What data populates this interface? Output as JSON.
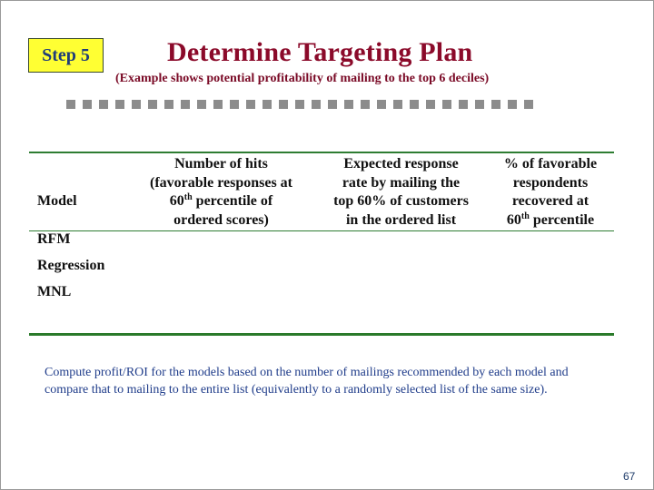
{
  "step_badge": "Step 5",
  "title": "Determine Targeting Plan",
  "subtitle": "(Example shows potential profitability of mailing to the top 6 deciles)",
  "decorative_dot_count": 29,
  "table": {
    "headers": {
      "model": "Model",
      "hits": {
        "line1": "Number of hits",
        "line2": "(favorable responses at",
        "line3_num": "60",
        "line3_sup": "th",
        "line3_rest": " percentile of",
        "line4": "ordered scores)"
      },
      "rate": {
        "line1": "Expected response",
        "line2": "rate by mailing the",
        "line3": "top 60% of customers",
        "line4": "in the ordered list"
      },
      "pct": {
        "line1": "% of favorable",
        "line2": "respondents",
        "line3": "recovered at",
        "line4_num": "60",
        "line4_sup": "th",
        "line4_rest": " percentile"
      }
    },
    "rows": [
      {
        "model": "RFM",
        "hits": "",
        "rate": "",
        "pct": ""
      },
      {
        "model": "Regression",
        "hits": "",
        "rate": "",
        "pct": ""
      },
      {
        "model": "MNL",
        "hits": "",
        "rate": "",
        "pct": ""
      }
    ]
  },
  "note": "Compute profit/ROI for the models based on the number of mailings recommended by each model and compare that to mailing to the entire list (equivalently to a randomly selected list of the same size).",
  "page_number": "67",
  "colors": {
    "title": "#8b0a2a",
    "badge_bg": "#ffff33",
    "badge_text": "#1f3c7a",
    "rule": "#2e7d32",
    "note_text": "#1f3c8a",
    "dots": "#8c8c8c"
  }
}
